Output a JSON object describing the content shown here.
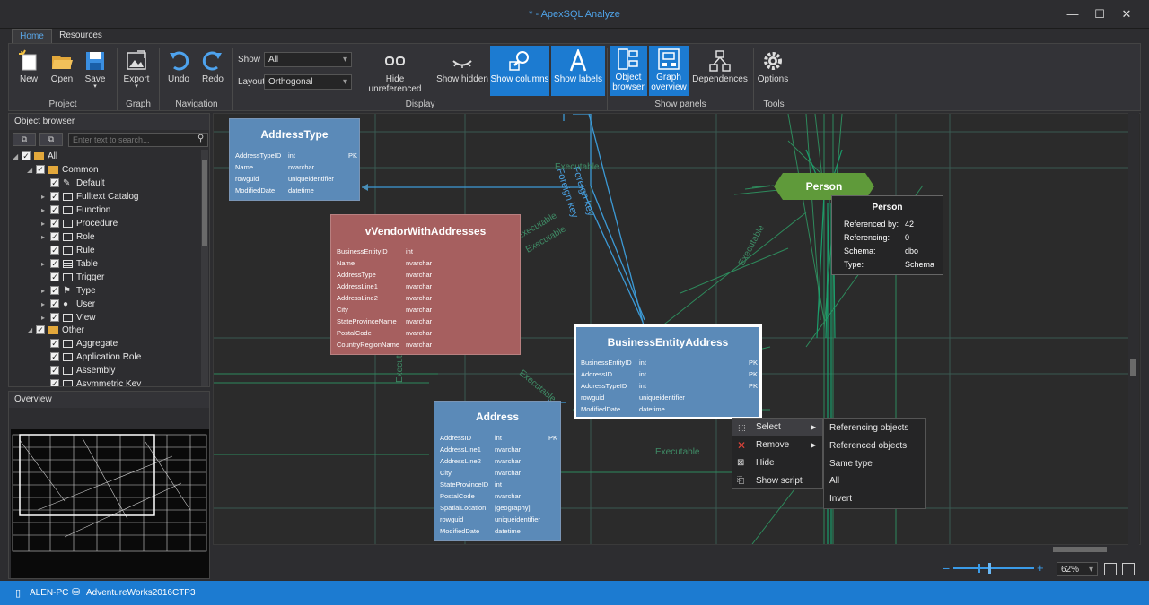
{
  "window": {
    "title": "* - ApexSQL Analyze"
  },
  "tabs": [
    {
      "label": "Home"
    },
    {
      "label": "Resources"
    }
  ],
  "ribbon": {
    "project": {
      "group_label": "Project",
      "new": "New",
      "open": "Open",
      "save": "Save"
    },
    "graph": {
      "group_label": "Graph",
      "export": "Export"
    },
    "navigation": {
      "group_label": "Navigation",
      "undo": "Undo",
      "redo": "Redo"
    },
    "display": {
      "group_label": "Display",
      "show_label": "Show",
      "show_value": "All",
      "layout_label": "Layout",
      "layout_value": "Orthogonal",
      "hide_unreferenced": "Hide unreferenced",
      "show_hidden": "Show hidden",
      "show_columns": "Show columns",
      "show_labels": "Show labels"
    },
    "show_panels": {
      "group_label": "Show panels",
      "object_browser_1": "Object",
      "object_browser_2": "browser",
      "graph_overview_1": "Graph",
      "graph_overview_2": "overview",
      "dependences": "Dependences"
    },
    "tools": {
      "group_label": "Tools",
      "options": "Options"
    }
  },
  "object_browser": {
    "title": "Object browser",
    "search_placeholder": "Enter text to search...",
    "items": [
      {
        "label": "All"
      },
      {
        "label": "Common"
      },
      {
        "label": "Default"
      },
      {
        "label": "Fulltext Catalog"
      },
      {
        "label": "Function"
      },
      {
        "label": "Procedure"
      },
      {
        "label": "Role"
      },
      {
        "label": "Rule"
      },
      {
        "label": "Table"
      },
      {
        "label": "Trigger"
      },
      {
        "label": "Type"
      },
      {
        "label": "User"
      },
      {
        "label": "View"
      },
      {
        "label": "Other"
      },
      {
        "label": "Aggregate"
      },
      {
        "label": "Application Role"
      },
      {
        "label": "Assembly"
      },
      {
        "label": "Asymmetric Key"
      }
    ]
  },
  "overview": {
    "title": "Overview"
  },
  "diagram": {
    "edge_labels": {
      "executable": "Executable",
      "foreign_key": "Foreign key"
    },
    "nodes": {
      "address_type": {
        "title": "AddressType",
        "columns": [
          {
            "name": "AddressTypeID",
            "type": "int",
            "key": "PK"
          },
          {
            "name": "Name",
            "type": "nvarchar",
            "key": ""
          },
          {
            "name": "rowguid",
            "type": "uniqueidentifier",
            "key": ""
          },
          {
            "name": "ModifiedDate",
            "type": "datetime",
            "key": ""
          }
        ]
      },
      "vvendor": {
        "title": "vVendorWithAddresses",
        "columns": [
          {
            "name": "BusinessEntityID",
            "type": "int"
          },
          {
            "name": "Name",
            "type": "nvarchar"
          },
          {
            "name": "AddressType",
            "type": "nvarchar"
          },
          {
            "name": "AddressLine1",
            "type": "nvarchar"
          },
          {
            "name": "AddressLine2",
            "type": "nvarchar"
          },
          {
            "name": "City",
            "type": "nvarchar"
          },
          {
            "name": "StateProvinceName",
            "type": "nvarchar"
          },
          {
            "name": "PostalCode",
            "type": "nvarchar"
          },
          {
            "name": "CountryRegionName",
            "type": "nvarchar"
          }
        ]
      },
      "bea": {
        "title": "BusinessEntityAddress",
        "columns": [
          {
            "name": "BusinessEntityID",
            "type": "int",
            "key": "PK"
          },
          {
            "name": "AddressID",
            "type": "int",
            "key": "PK"
          },
          {
            "name": "AddressTypeID",
            "type": "int",
            "key": "PK"
          },
          {
            "name": "rowguid",
            "type": "uniqueidentifier",
            "key": ""
          },
          {
            "name": "ModifiedDate",
            "type": "datetime",
            "key": ""
          }
        ]
      },
      "address": {
        "title": "Address",
        "columns": [
          {
            "name": "AddressID",
            "type": "int",
            "key": "PK"
          },
          {
            "name": "AddressLine1",
            "type": "nvarchar",
            "key": ""
          },
          {
            "name": "AddressLine2",
            "type": "nvarchar",
            "key": ""
          },
          {
            "name": "City",
            "type": "nvarchar",
            "key": ""
          },
          {
            "name": "StateProvinceID",
            "type": "int",
            "key": ""
          },
          {
            "name": "PostalCode",
            "type": "nvarchar",
            "key": ""
          },
          {
            "name": "SpatialLocation",
            "type": "[geography]",
            "key": ""
          },
          {
            "name": "rowguid",
            "type": "uniqueidentifier",
            "key": ""
          },
          {
            "name": "ModifiedDate",
            "type": "datetime",
            "key": ""
          }
        ]
      },
      "person": {
        "title": "Person"
      }
    }
  },
  "tooltip": {
    "title": "Person",
    "rows": [
      {
        "key": "Referenced by:",
        "value": "42"
      },
      {
        "key": "Referencing:",
        "value": "0"
      },
      {
        "key": "Schema:",
        "value": "dbo"
      },
      {
        "key": "Type:",
        "value": "Schema"
      }
    ]
  },
  "context_menu": {
    "items": [
      {
        "label": "Select"
      },
      {
        "label": "Remove"
      },
      {
        "label": "Hide"
      },
      {
        "label": "Show script"
      }
    ]
  },
  "submenu": {
    "items": [
      {
        "label": "Referencing objects"
      },
      {
        "label": "Referenced objects"
      },
      {
        "label": "Same type"
      },
      {
        "label": "All"
      },
      {
        "label": "Invert"
      }
    ]
  },
  "zoom": {
    "value": "62%"
  },
  "status": {
    "server": "ALEN-PC",
    "database": "AdventureWorks2016CTP3"
  },
  "colors": {
    "accent": "#1c7bd1",
    "table_node": "#5b8ab8",
    "view_node": "#a65f5f",
    "schema_node": "#5f9a3a"
  }
}
